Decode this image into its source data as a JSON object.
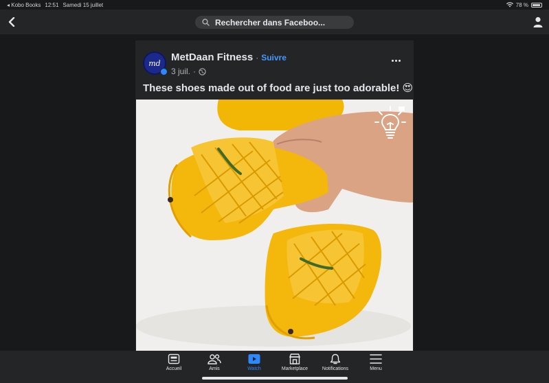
{
  "status_bar": {
    "back_app": "◂ Kobo Books",
    "time": "12:51",
    "date": "Samedi 15 juillet",
    "battery": "78 %"
  },
  "search": {
    "placeholder": "Rechercher dans Faceboo..."
  },
  "post": {
    "author": "MetDaan Fitness",
    "separator": "·",
    "follow_label": "Suivre",
    "date": "3 juil.",
    "meta_separator": "·",
    "caption": "These shoes made out of food are just too adorable! 😍",
    "avatar_text": "md",
    "media_description_icon": "lightbulb-icon"
  },
  "bottom_nav": {
    "items": [
      {
        "label": "Accueil",
        "icon": "home-icon"
      },
      {
        "label": "Amis",
        "icon": "friends-icon"
      },
      {
        "label": "Watch",
        "icon": "watch-icon",
        "active": true
      },
      {
        "label": "Marketplace",
        "icon": "marketplace-icon"
      },
      {
        "label": "Notifications",
        "icon": "bell-icon"
      },
      {
        "label": "Menu",
        "icon": "menu-icon"
      }
    ]
  },
  "colors": {
    "background": "#18191a",
    "surface": "#242526",
    "accent_blue": "#2d88ff",
    "follow_blue": "#4599ff",
    "mango_yellow": "#f2b705"
  }
}
